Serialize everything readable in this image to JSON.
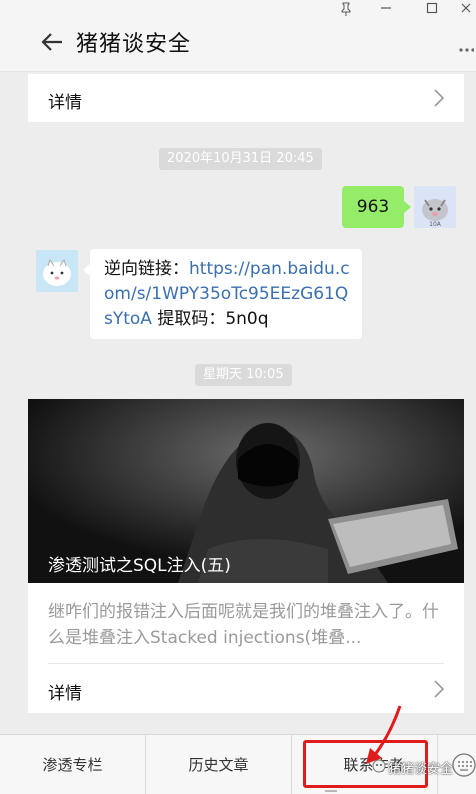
{
  "window": {
    "pin_icon": "pin-icon",
    "minimize_icon": "minimize-icon",
    "maximize_icon": "maximize-icon",
    "close_icon": "close-icon"
  },
  "header": {
    "title": "猪猪谈安全",
    "back_icon": "arrow-left-icon",
    "more_icon": "more-icon"
  },
  "messages": {
    "top_detail_label": "详情",
    "timestamp1": "2020年10月31日 20:45",
    "user_message": "963",
    "reply_prefix": "逆向链接：",
    "reply_link": "https://pan.baidu.com/s/1WPY35oTc95EEzG61QsYtoA",
    "reply_suffix": " 提取码：5n0q",
    "timestamp2": "星期天 10:05"
  },
  "article": {
    "title": "渗透测试之SQL注入(五)",
    "summary": "继咋们的报错注入后面呢就是我们的堆叠注入了。什么是堆叠注入Stacked injections(堆叠...",
    "detail_label": "详情"
  },
  "bottom_menu": {
    "items": [
      {
        "label": "渗透专栏"
      },
      {
        "label": "历史文章"
      },
      {
        "label": "联系作者"
      }
    ],
    "keyboard_icon": "keyboard-icon",
    "watermark": "猪猪谈安全"
  },
  "colors": {
    "accent_green": "#95ec69",
    "link_blue": "#3a6fb0",
    "highlight_red": "#e01b1b"
  }
}
